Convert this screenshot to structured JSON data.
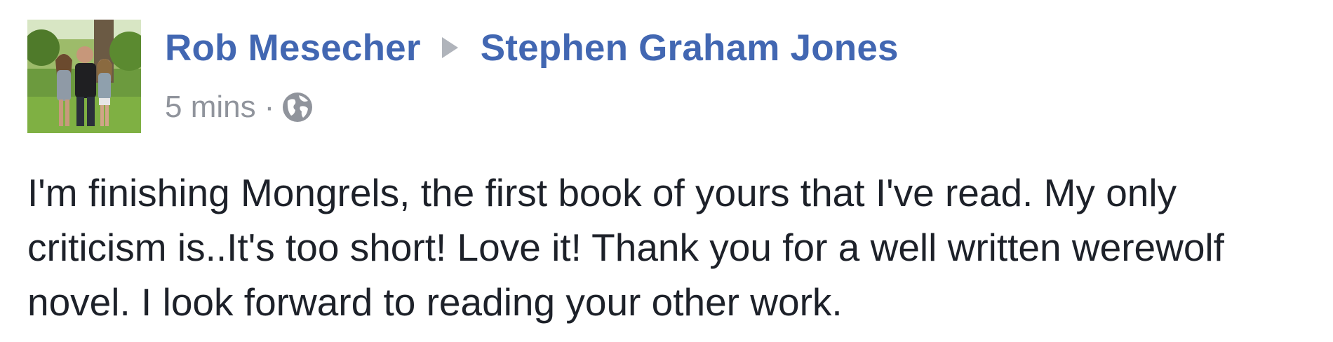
{
  "post": {
    "author": "Rob Mesecher",
    "target": "Stephen Graham Jones",
    "timestamp": "5 mins",
    "separator": "·",
    "privacy_icon": "globe-icon",
    "text": "I'm finishing Mongrels, the first book of yours that I've read. My only criticism is..It's too short! Love it! Thank you for a well written werewolf novel. I look forward to reading your other work."
  },
  "colors": {
    "link": "#4267b2",
    "meta": "#90949c",
    "body_text": "#1d2129",
    "arrow": "#b0b4bb"
  }
}
